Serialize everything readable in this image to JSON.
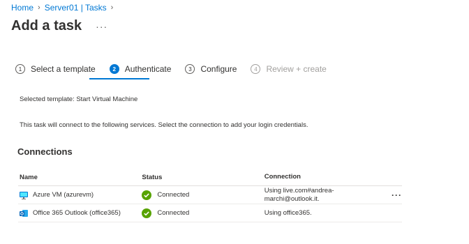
{
  "breadcrumb": {
    "home": "Home",
    "server": "Server01 | Tasks"
  },
  "page": {
    "title": "Add a task",
    "more": "···"
  },
  "wizard": {
    "steps": [
      {
        "number": "1",
        "label": "Select a template",
        "state": "done"
      },
      {
        "number": "2",
        "label": "Authenticate",
        "state": "active"
      },
      {
        "number": "3",
        "label": "Configure",
        "state": "pending"
      },
      {
        "number": "4",
        "label": "Review + create",
        "state": "disabled"
      }
    ]
  },
  "content": {
    "selected_template": "Selected template: Start Virtual Machine",
    "description": "This task will connect to the following services. Select the connection to add your login credentials."
  },
  "connections": {
    "title": "Connections",
    "columns": {
      "name": "Name",
      "status": "Status",
      "connection": "Connection"
    },
    "rows": [
      {
        "icon": "azure-vm-icon",
        "name": "Azure VM (azurevm)",
        "status": "Connected",
        "connection": "Using live.com#andrea-marchi@outlook.it.",
        "more": "···"
      },
      {
        "icon": "outlook-icon",
        "name": "Office 365 Outlook (office365)",
        "status": "Connected",
        "connection": "Using office365.",
        "more": ""
      }
    ]
  },
  "colors": {
    "accent": "#0078d4",
    "success": "#57a300",
    "text": "#323130"
  }
}
